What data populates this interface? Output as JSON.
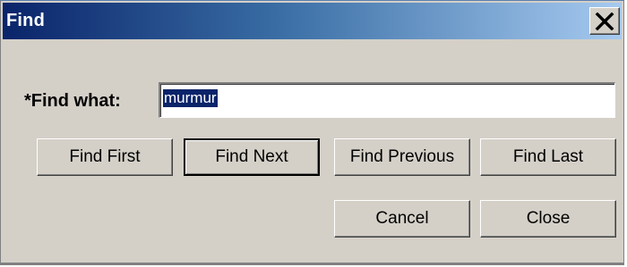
{
  "window": {
    "title": "Find",
    "close_icon": "close-x-icon"
  },
  "form": {
    "find_what_label": "*Find what:",
    "find_what_value": "murmur",
    "find_what_selected": true
  },
  "buttons": {
    "find_first": "Find First",
    "find_next": "Find Next",
    "find_previous": "Find Previous",
    "find_last": "Find Last",
    "cancel": "Cancel",
    "close": "Close"
  },
  "colors": {
    "title_gradient_start": "#0a246a",
    "title_gradient_end": "#a6caf0",
    "dialog_background": "#d4d0c8",
    "selection_background": "#0a246a"
  }
}
